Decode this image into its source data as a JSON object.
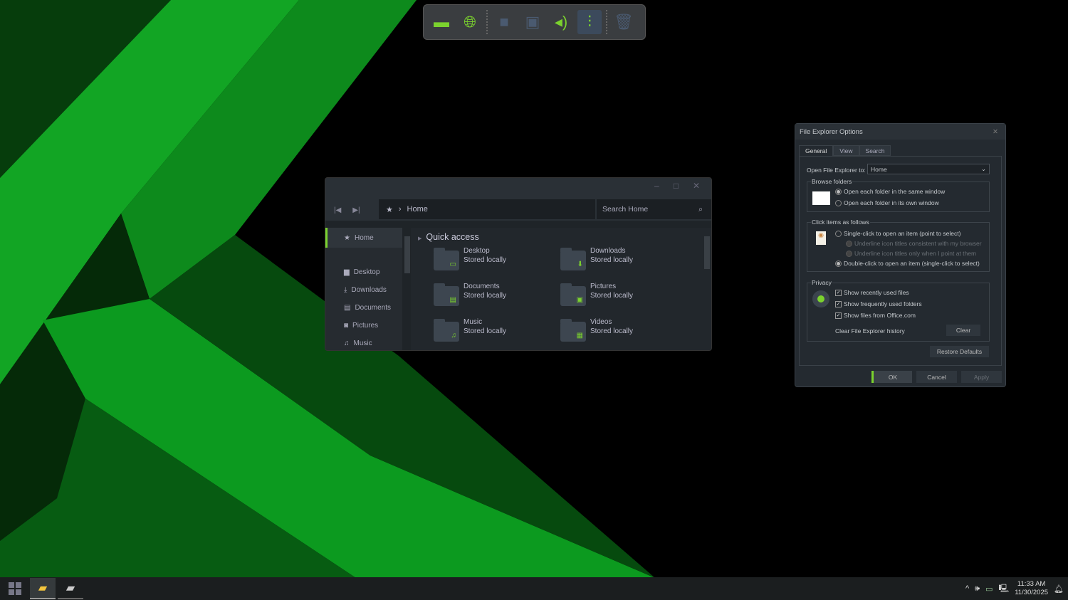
{
  "colors": {
    "accent": "#7bd22e",
    "bg_green": "#0faa22"
  },
  "dock": {
    "icons": [
      "monitor-icon",
      "globe-network-icon",
      "home-folder-icon",
      "windows-drive-icon",
      "speaker-icon",
      "equalizer-icon",
      "trash-icon"
    ]
  },
  "explorer": {
    "address": "Home",
    "search_placeholder": "Search Home",
    "sidebar": [
      {
        "label": "Home",
        "icon": "star-icon"
      },
      {
        "label": "Desktop",
        "icon": "desktop-folder-icon"
      },
      {
        "label": "Downloads",
        "icon": "download-icon"
      },
      {
        "label": "Documents",
        "icon": "document-icon"
      },
      {
        "label": "Pictures",
        "icon": "camera-icon"
      },
      {
        "label": "Music",
        "icon": "music-icon"
      }
    ],
    "section": "Quick access",
    "items": [
      {
        "name": "Desktop",
        "sub": "Stored locally",
        "icon": "▭"
      },
      {
        "name": "Downloads",
        "sub": "Stored locally",
        "icon": "⬇"
      },
      {
        "name": "Documents",
        "sub": "Stored locally",
        "icon": "▤"
      },
      {
        "name": "Pictures",
        "sub": "Stored locally",
        "icon": "▣"
      },
      {
        "name": "Music",
        "sub": "Stored locally",
        "icon": "♫"
      },
      {
        "name": "Videos",
        "sub": "Stored locally",
        "icon": "▦"
      }
    ]
  },
  "dialog": {
    "title": "File Explorer Options",
    "tabs": [
      "General",
      "View",
      "Search"
    ],
    "open_to_label": "Open File Explorer to:",
    "open_to_value": "Home",
    "browse_label": "Browse folders",
    "browse_same": "Open each folder in the same window",
    "browse_own": "Open each folder in its own window",
    "click_label": "Click items as follows",
    "single_click": "Single-click to open an item (point to select)",
    "underline_browser": "Underline icon titles consistent with my browser",
    "underline_point": "Underline icon titles only when I point at them",
    "double_click": "Double-click to open an item (single-click to select)",
    "privacy_label": "Privacy",
    "recent_files": "Show recently used files",
    "frequent_folders": "Show frequently used folders",
    "office_files": "Show files from Office.com",
    "clear_history": "Clear File Explorer history",
    "clear": "Clear",
    "restore": "Restore Defaults",
    "ok": "OK",
    "cancel": "Cancel",
    "apply": "Apply"
  },
  "taskbar": {
    "time": "11:33 AM",
    "date": "11/30/2025"
  }
}
